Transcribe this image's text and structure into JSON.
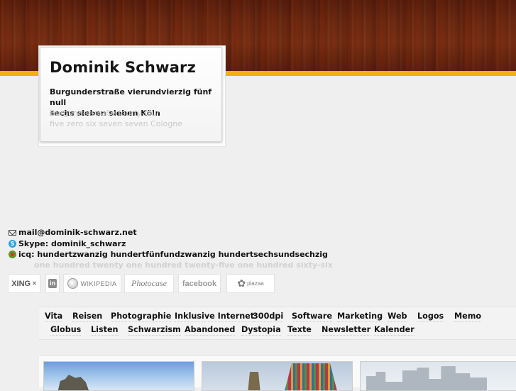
{
  "header": {
    "name": "Dominik Schwarz",
    "address_de_line1": "Burgunderstraße vierundvierzig fünf null",
    "address_de_line2": "sechs sieben sieben Köln",
    "address_en_line1": "Burgunderstraße fourty-four",
    "address_en_line2": "five zero six seven seven Cologne"
  },
  "contact": {
    "email": "mail@dominik-schwarz.net",
    "skype": "Skype: dominik_schwarz",
    "icq": "icq: hundertzwanzig hundertfünfundzwanzig hundertsechsundsechzig",
    "icq_en": "one hundred twenty one hundred twenty-five one hundred sixty-six"
  },
  "social": {
    "xing": "XING",
    "linkedin": "in",
    "wikipedia": "WIKIPEDIA",
    "photocase": "Photocase",
    "facebook": "facebook",
    "plazaa": "plazaa"
  },
  "nav": {
    "row1": [
      "Vita",
      "Reisen",
      "Photographie",
      "Inklusive Internet",
      "300dpi",
      "Software",
      "Marketing",
      "Web",
      "Logos",
      "Memo"
    ],
    "row2": [
      "Globus",
      "Listen",
      "Schwarzism",
      "Abandoned",
      "Dystopia",
      "Texte",
      "Newsletter",
      "Kalender"
    ]
  },
  "colors": {
    "accent_stripe": "#f2b10f",
    "wood": "#6e2a12",
    "background": "#efefef"
  }
}
